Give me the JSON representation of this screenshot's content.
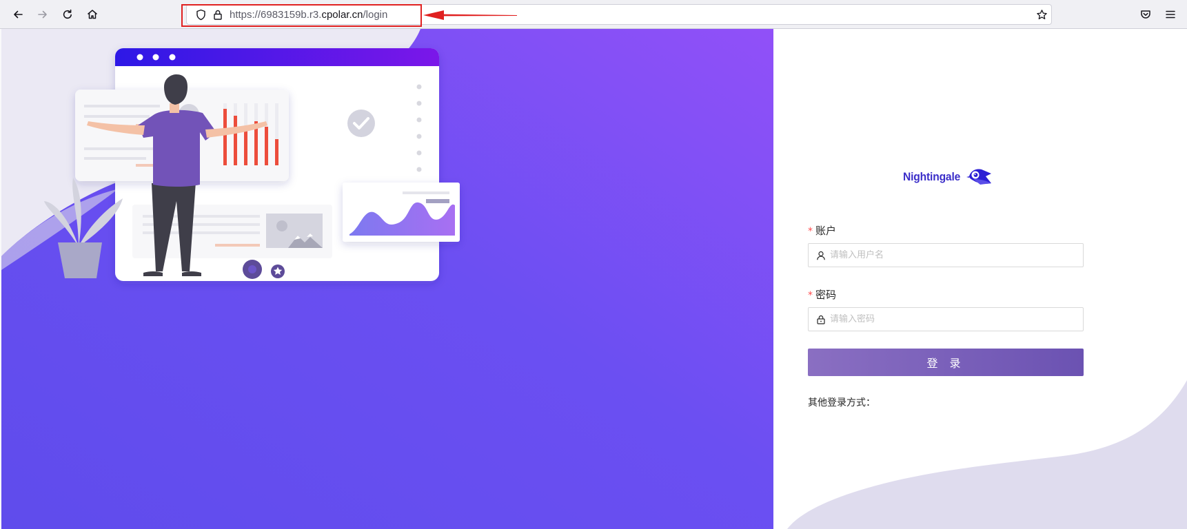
{
  "browser": {
    "url_prefix": "https://6983159b.r3.",
    "url_host": "cpolar.cn",
    "url_path": "/login",
    "icons": [
      "back-arrow-icon",
      "forward-arrow-icon",
      "reload-icon",
      "home-icon",
      "shield-icon",
      "lock-icon",
      "star-icon",
      "pocket-icon",
      "menu-icon"
    ],
    "annotation_color": "#e02020"
  },
  "brand": {
    "name": "Nightingale",
    "color": "#3b2ec9"
  },
  "form": {
    "account_label": "账户",
    "account_placeholder": "请输入用户名",
    "password_label": "密码",
    "password_placeholder": "请输入密码",
    "required_mark": "*",
    "submit_label": "登 录",
    "other_login_label": "其他登录方式："
  },
  "colors": {
    "gradient_start": "#8b4cf7",
    "gradient_end": "#5a4de8",
    "accent": "#6b52b2",
    "required": "#ff4d4f"
  }
}
